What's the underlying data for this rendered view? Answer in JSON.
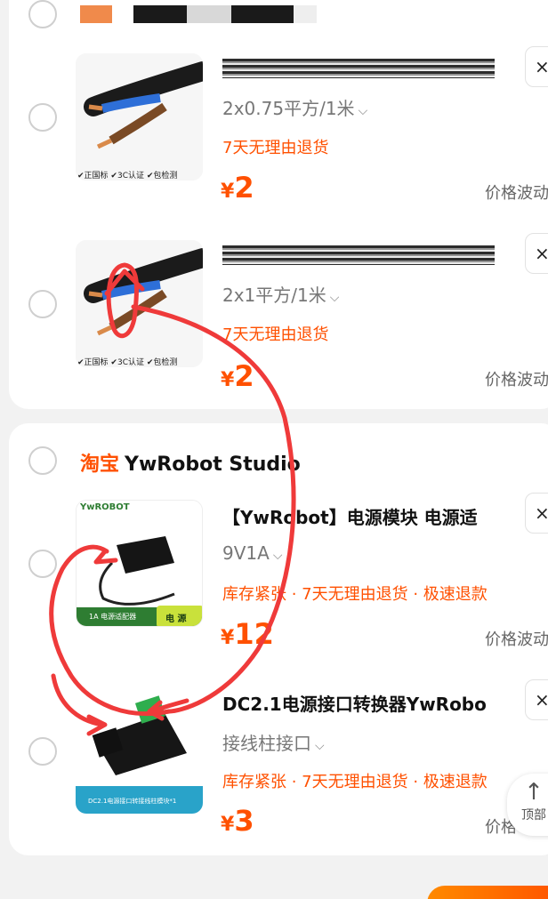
{
  "cart": {
    "store_group_1": {
      "items": [
        {
          "spec": "2x0.75平方/1米",
          "tag": "7天无理由退货",
          "price_symbol": "¥",
          "price": "2",
          "price_note": "价格波动",
          "delete": "×"
        },
        {
          "spec": "2x1平方/1米",
          "tag": "7天无理由退货",
          "price_symbol": "¥",
          "price": "2",
          "price_note": "价格波动",
          "delete": "×"
        }
      ],
      "product_badges": [
        "✔正国标",
        "✔3C认证",
        "✔包检测"
      ]
    },
    "store_group_2": {
      "store_prefix": "淘宝",
      "store_name": "YwRobot Studio",
      "items": [
        {
          "title": "【YwRobot】电源模块  电源适",
          "spec": "9V1A",
          "tag": "库存紧张 · 7天无理由退货 · 极速退款",
          "price_symbol": "¥",
          "price": "12",
          "price_note": "价格波动",
          "delete": "×",
          "thumb_brand": "YwROBOT",
          "thumb_caption": "1A 电源适配器",
          "thumb_badge": "电 源"
        },
        {
          "title": "DC2.1电源接口转换器YwRobo",
          "spec": "接线柱接口",
          "tag": "库存紧张 · 7天无理由退货 · 极速退款",
          "price_symbol": "¥",
          "price": "3",
          "price_note": "价格",
          "delete": "×",
          "thumb_caption": "DC2.1电源接口转接线柱模块*1"
        }
      ]
    }
  },
  "back_to_top": {
    "arrow": "↑",
    "label": "顶部"
  },
  "colors": {
    "accent": "#ff5000",
    "annotation": "#ef3a3a"
  }
}
